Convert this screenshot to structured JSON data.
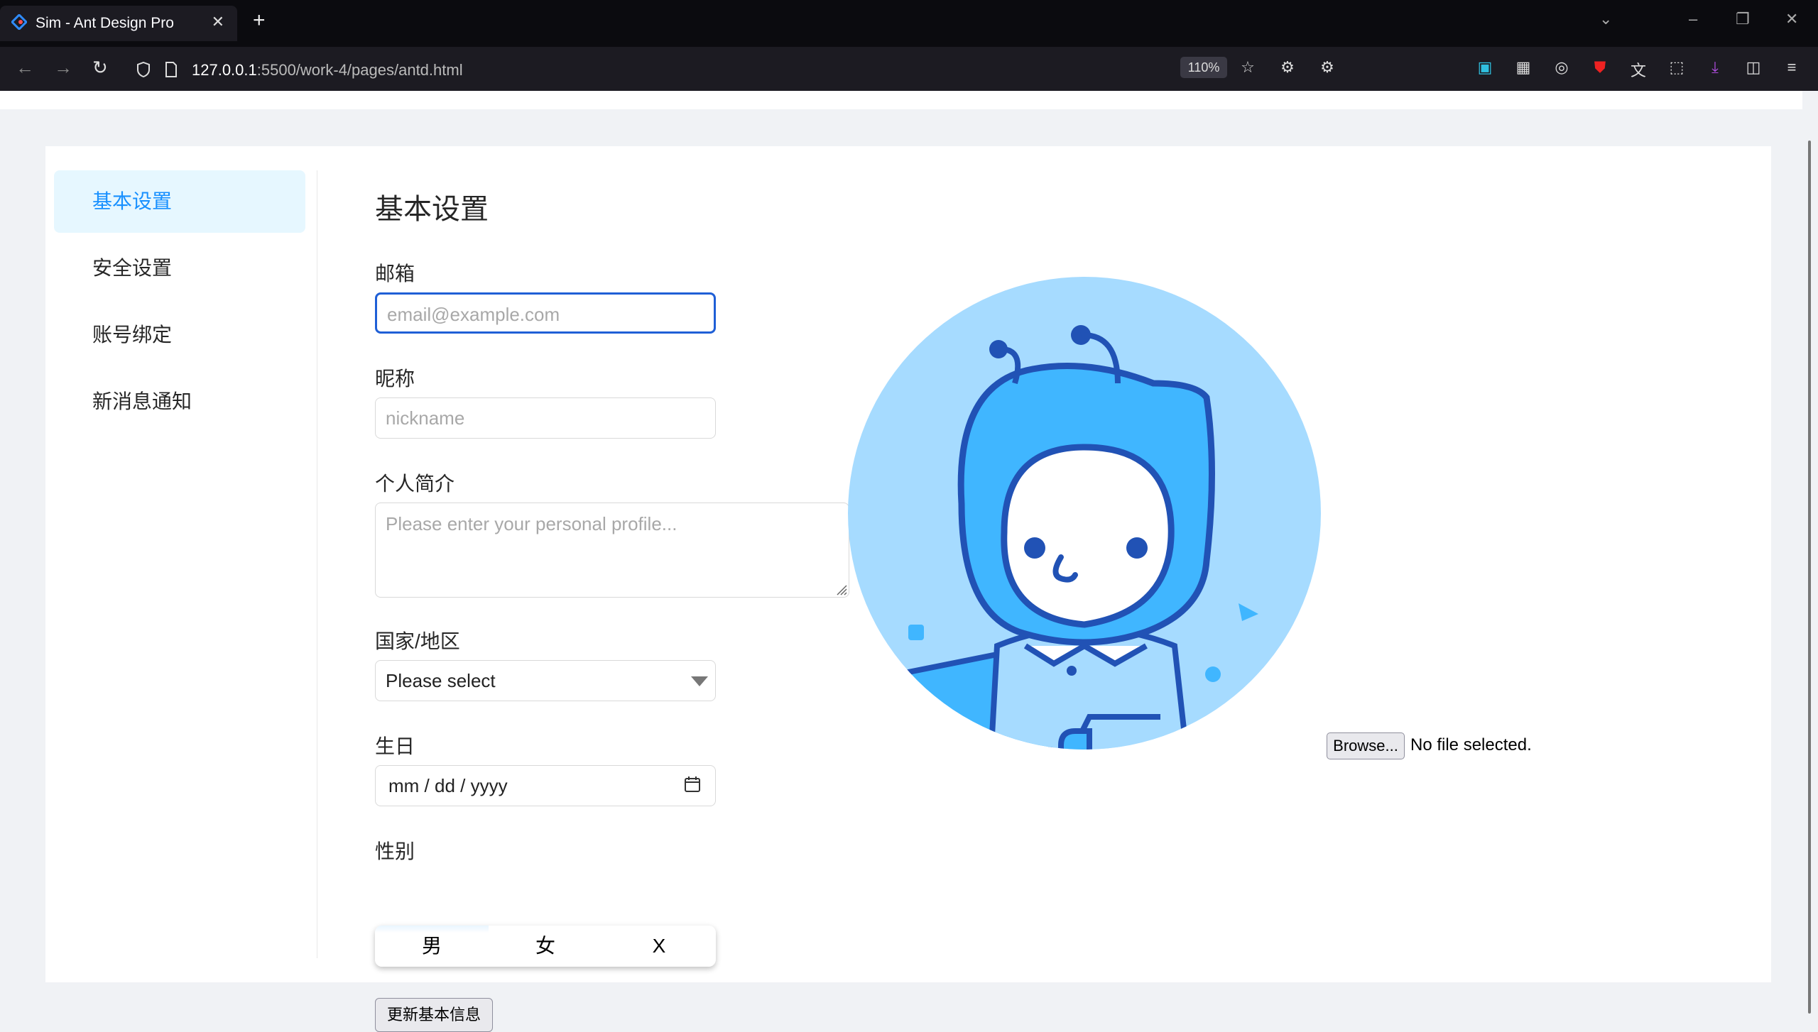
{
  "browser": {
    "tab_title": "Sim - Ant Design Pro",
    "tab_close": "✕",
    "new_tab": "+",
    "url_host": "127.0.0.1",
    "url_path": ":5500/work-4/pages/antd.html",
    "zoom": "110%"
  },
  "sidebar": {
    "items": [
      {
        "label": "基本设置",
        "active": true
      },
      {
        "label": "安全设置",
        "active": false
      },
      {
        "label": "账号绑定",
        "active": false
      },
      {
        "label": "新消息通知",
        "active": false
      }
    ]
  },
  "form": {
    "title": "基本设置",
    "email_label": "邮箱",
    "email_placeholder": "email@example.com",
    "nickname_label": "昵称",
    "nickname_placeholder": "nickname",
    "profile_label": "个人简介",
    "profile_placeholder": "Please enter your personal profile...",
    "country_label": "国家/地区",
    "country_value": "Please select",
    "birthday_label": "生日",
    "birthday_value": "mm / dd / yyyy",
    "gender_label": "性别",
    "gender_options": [
      "男",
      "女",
      "X"
    ],
    "submit_label": "更新基本信息"
  },
  "upload": {
    "browse_label": "Browse...",
    "status": "No file selected."
  },
  "colors": {
    "accent": "#1890ff",
    "active_bg": "#e6f7ff",
    "avatar_bg": "#a6dbff",
    "avatar_helmet": "#40b6ff",
    "avatar_line": "#2152b5"
  }
}
